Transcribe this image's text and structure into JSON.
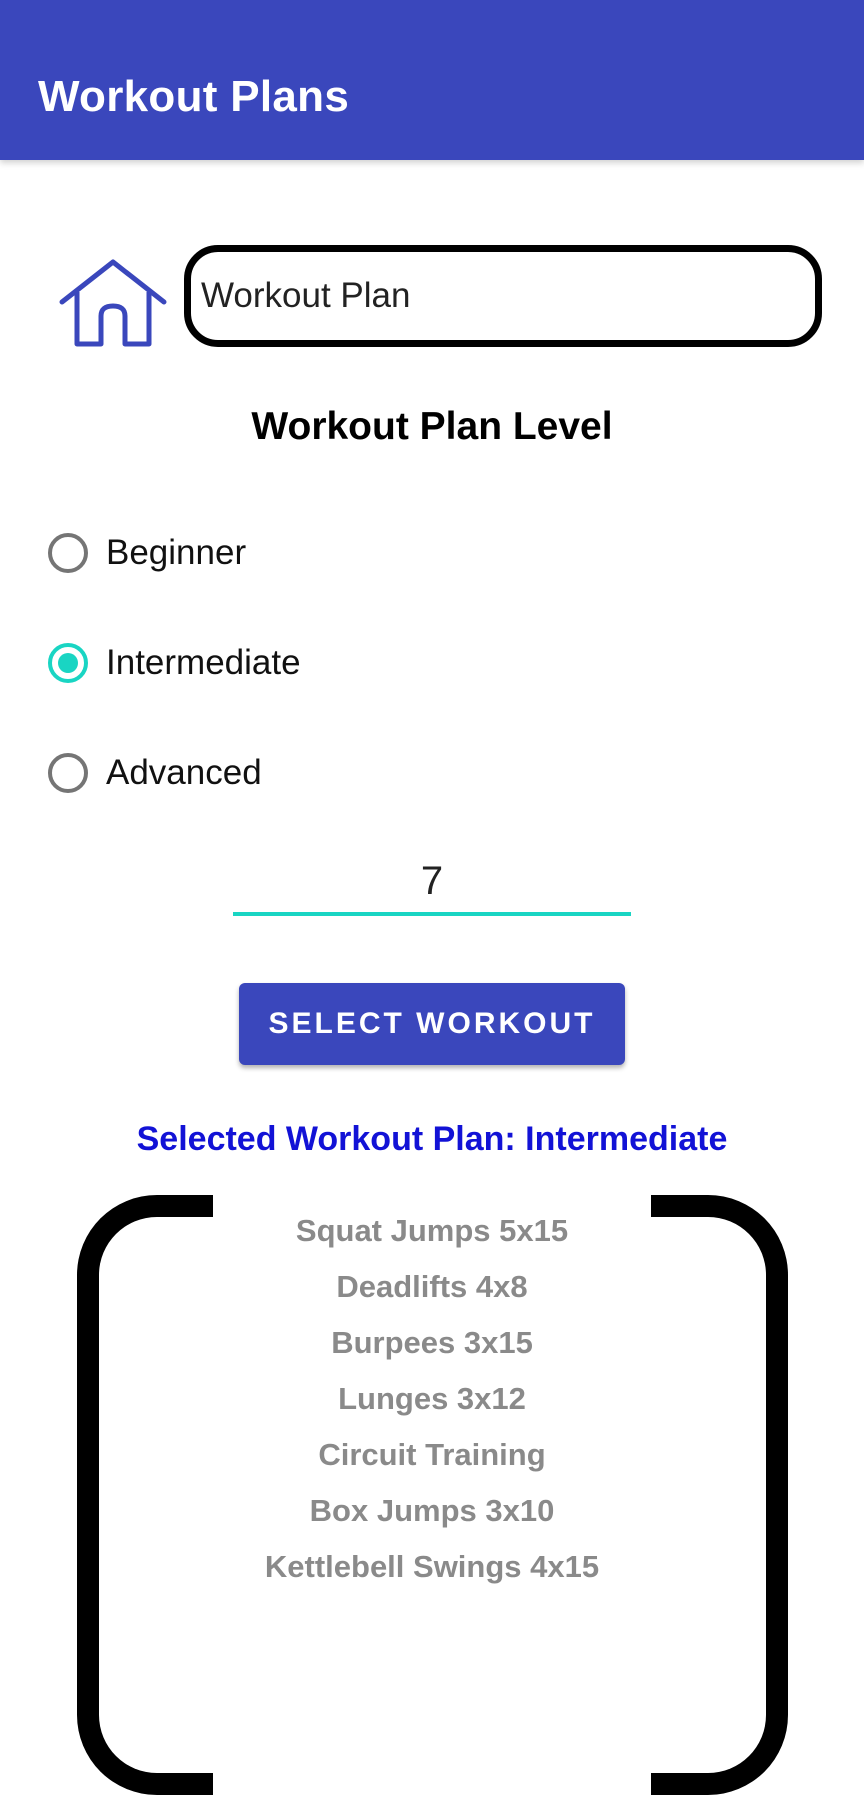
{
  "app_bar": {
    "title": "Workout Plans"
  },
  "name_input": {
    "value": "Workout Plan"
  },
  "level_section": {
    "heading": "Workout Plan Level",
    "options": [
      {
        "label": "Beginner",
        "checked": false
      },
      {
        "label": "Intermediate",
        "checked": true
      },
      {
        "label": "Advanced",
        "checked": false
      }
    ]
  },
  "number_input": {
    "value": "7"
  },
  "select_button": {
    "label": "SELECT WORKOUT"
  },
  "selected_plan_text": "Selected Workout Plan: Intermediate",
  "exercises": [
    "Squat Jumps 5x15",
    "Deadlifts 4x8",
    "Burpees 3x15",
    "Lunges 3x12",
    "Circuit Training",
    "Box Jumps 3x10",
    "Kettlebell Swings 4x15"
  ],
  "colors": {
    "primary": "#3A47BC",
    "accent": "#19D5C3",
    "selected_text": "#1212D6",
    "exercise_text": "#8A8A8A"
  },
  "icons": {
    "home": "home-icon"
  }
}
